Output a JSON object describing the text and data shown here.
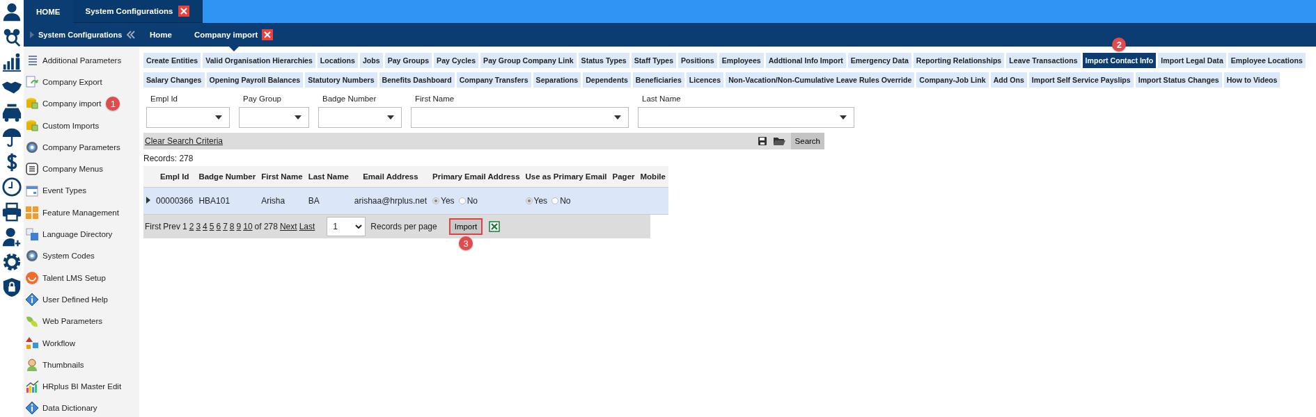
{
  "top_tabs": [
    {
      "label": "HOME",
      "selected": false,
      "closable": false
    },
    {
      "label": "System Configurations",
      "selected": true,
      "closable": true
    }
  ],
  "breadcrumb": {
    "section": "System Configurations",
    "items": [
      {
        "label": "Home",
        "selected": false,
        "closable": false
      },
      {
        "label": "Company import",
        "selected": true,
        "closable": true
      }
    ]
  },
  "sidebar": {
    "items": [
      {
        "label": "Additional Parameters"
      },
      {
        "label": "Company Export"
      },
      {
        "label": "Company import",
        "badge": "1"
      },
      {
        "label": "Custom Imports"
      },
      {
        "label": "Company Parameters"
      },
      {
        "label": "Company Menus"
      },
      {
        "label": "Event Types"
      },
      {
        "label": "Feature Management"
      },
      {
        "label": "Language Directory"
      },
      {
        "label": "System Codes"
      },
      {
        "label": "Talent LMS Setup"
      },
      {
        "label": "User Defined Help"
      },
      {
        "label": "Web Parameters"
      },
      {
        "label": "Workflow"
      },
      {
        "label": "Thumbnails"
      },
      {
        "label": "HRplus BI Master Edit"
      },
      {
        "label": "Data Dictionary"
      }
    ]
  },
  "tab_rows": [
    [
      {
        "label": "Create Entities",
        "selected": false
      },
      {
        "label": "Valid Organisation Hierarchies",
        "selected": false
      },
      {
        "label": "Locations",
        "selected": false
      },
      {
        "label": "Jobs",
        "selected": false
      },
      {
        "label": "Pay Groups",
        "selected": false
      },
      {
        "label": "Pay Cycles",
        "selected": false
      },
      {
        "label": "Pay Group Company Link",
        "selected": false
      },
      {
        "label": "Status Types",
        "selected": false
      },
      {
        "label": "Staff Types",
        "selected": false
      },
      {
        "label": "Positions",
        "selected": false
      },
      {
        "label": "Employees",
        "selected": false
      },
      {
        "label": "Addtional Info Import",
        "selected": false
      },
      {
        "label": "Emergency Data",
        "selected": false
      },
      {
        "label": "Reporting Relationships",
        "selected": false
      },
      {
        "label": "Leave Transactions",
        "selected": false
      },
      {
        "label": "Import Contact Info",
        "selected": true,
        "badge": "2"
      },
      {
        "label": "Import Legal Data",
        "selected": false
      },
      {
        "label": "Employee Locations",
        "selected": false
      }
    ],
    [
      {
        "label": "Salary Changes",
        "selected": false
      },
      {
        "label": "Opening Payroll Balances",
        "selected": false
      },
      {
        "label": "Statutory Numbers",
        "selected": false
      },
      {
        "label": "Benefits Dashboard",
        "selected": false
      },
      {
        "label": "Company Transfers",
        "selected": false
      },
      {
        "label": "Separations",
        "selected": false
      },
      {
        "label": "Dependents",
        "selected": false
      },
      {
        "label": "Beneficiaries",
        "selected": false
      },
      {
        "label": "Licences",
        "selected": false
      },
      {
        "label": "Non-Vacation/Non-Cumulative Leave Rules Override",
        "selected": false
      },
      {
        "label": "Company-Job Link",
        "selected": false
      },
      {
        "label": "Add Ons",
        "selected": false
      },
      {
        "label": "Import Self Service Payslips",
        "selected": false
      },
      {
        "label": "Import Status Changes",
        "selected": false
      },
      {
        "label": "How to Videos",
        "selected": false
      }
    ]
  ],
  "filters": [
    {
      "label": "Empl Id"
    },
    {
      "label": "Pay Group"
    },
    {
      "label": "Badge Number"
    },
    {
      "label": "First Name"
    },
    {
      "label": "Last Name"
    }
  ],
  "search_bar": {
    "clear_link": "Clear Search Criteria",
    "search_button": "Search"
  },
  "records": {
    "label": "Records:",
    "count": "278"
  },
  "table": {
    "columns": [
      "Empl Id",
      "Badge Number",
      "First Name",
      "Last Name",
      "Email Address",
      "Primary Email Address",
      "Use as Primary Email",
      "Pager",
      "Mobile"
    ],
    "rows": [
      {
        "empl_id": "00000366",
        "badge_number": "HBA101",
        "first_name": "Arisha",
        "last_name": "BA",
        "email": "arishaa@hrplus.net",
        "primary_email_address": [
          {
            "label": "Yes",
            "selected": true
          },
          {
            "label": "No",
            "selected": false
          }
        ],
        "use_as_primary_email": [
          {
            "label": "Yes",
            "selected": true
          },
          {
            "label": "No",
            "selected": false
          }
        ],
        "disabled": true
      }
    ]
  },
  "pager": {
    "first": "First",
    "prev": "Prev",
    "pages": [
      {
        "label": "1",
        "selected": true
      },
      {
        "label": "2",
        "selected": false
      },
      {
        "label": "3",
        "selected": false
      },
      {
        "label": "4",
        "selected": false
      },
      {
        "label": "5",
        "selected": false
      },
      {
        "label": "6",
        "selected": false
      },
      {
        "label": "7",
        "selected": false
      },
      {
        "label": "8",
        "selected": false
      },
      {
        "label": "9",
        "selected": false
      },
      {
        "label": "10",
        "selected": false
      }
    ],
    "of_total": "of 278",
    "next": "Next",
    "last": "Last",
    "per_page_value": "1",
    "per_page_label": "Records per page",
    "import_button": "Import",
    "import_badge": "3"
  }
}
